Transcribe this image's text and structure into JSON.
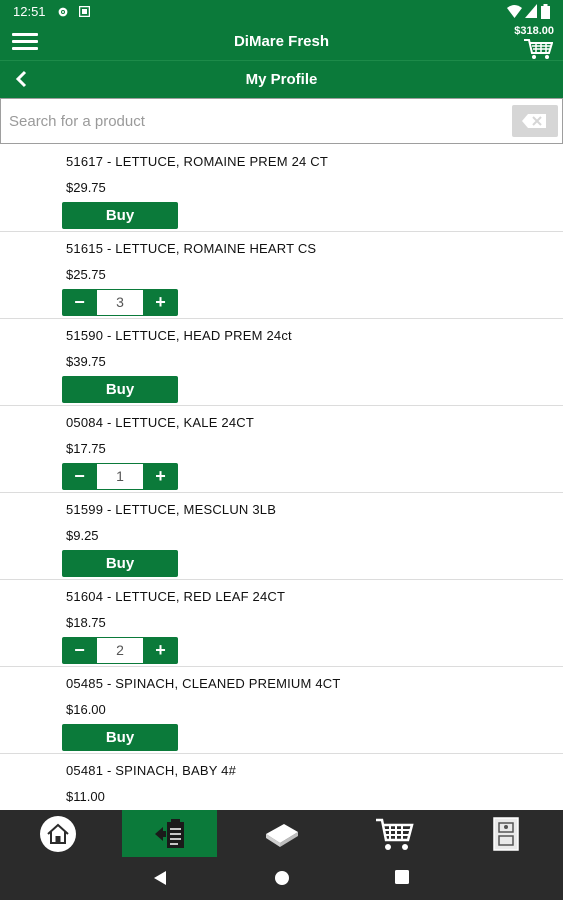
{
  "status": {
    "time": "12:51"
  },
  "header": {
    "title": "DiMare Fresh",
    "cart_total": "$318.00"
  },
  "subheader": {
    "title": "My Profile"
  },
  "search": {
    "placeholder": "Search for a product",
    "value": ""
  },
  "products": [
    {
      "name": "51617 - LETTUCE, ROMAINE PREM 24 CT",
      "price": "$29.75",
      "action": "Buy"
    },
    {
      "name": "51615 - LETTUCE, ROMAINE HEART CS",
      "price": "$25.75",
      "qty": "3"
    },
    {
      "name": "51590 - LETTUCE, HEAD PREM 24ct",
      "price": "$39.75",
      "action": "Buy"
    },
    {
      "name": "05084 - LETTUCE, KALE 24CT",
      "price": "$17.75",
      "qty": "1"
    },
    {
      "name": "51599 - LETTUCE, MESCLUN 3LB",
      "price": "$9.25",
      "action": "Buy"
    },
    {
      "name": "51604 - LETTUCE, RED LEAF 24CT",
      "price": "$18.75",
      "qty": "2"
    },
    {
      "name": "05485 - SPINACH, CLEANED PREMIUM 4CT",
      "price": "$16.00",
      "action": "Buy"
    },
    {
      "name": "05481 - SPINACH, BABY 4#",
      "price": "$11.00"
    }
  ],
  "stepper_labels": {
    "minus": "−",
    "plus": "+"
  },
  "bottom_nav": [
    {
      "icon": "home-icon"
    },
    {
      "icon": "order-guide-icon",
      "active": true
    },
    {
      "icon": "catalog-book-icon"
    },
    {
      "icon": "cart-icon"
    },
    {
      "icon": "account-icon"
    }
  ],
  "colors": {
    "brand_green": "#0b7a3a",
    "nav_dark": "#2b2b2b"
  }
}
